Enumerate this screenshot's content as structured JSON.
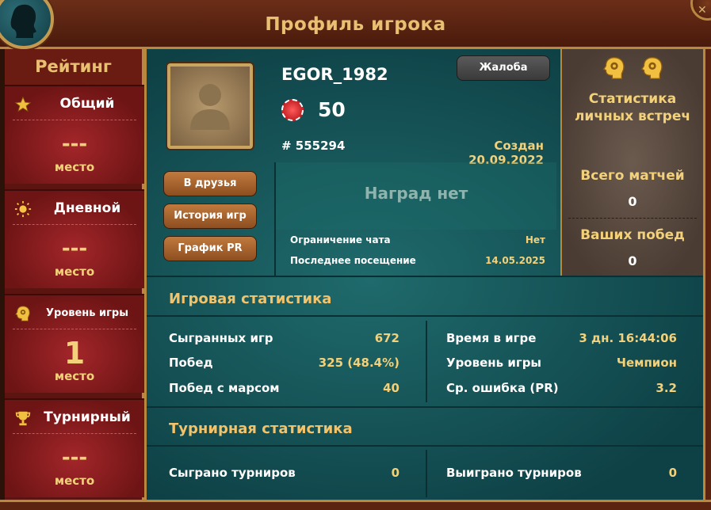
{
  "header": {
    "title": "Профиль игрока"
  },
  "rating": {
    "title": "Рейтинг",
    "items": [
      {
        "label": "Общий",
        "value": "---",
        "place": "место",
        "icon": "star-icon"
      },
      {
        "label": "Дневной",
        "value": "---",
        "place": "место",
        "icon": "sun-icon"
      },
      {
        "label": "Уровень игры",
        "value": "1",
        "place": "место",
        "icon": "brain-gear-icon"
      },
      {
        "label": "Турнирный",
        "value": "---",
        "place": "место",
        "icon": "trophy-icon"
      }
    ]
  },
  "profile": {
    "name": "EGOR_1982",
    "rating": "50",
    "id": "# 555294",
    "created": "Создан 20.09.2022",
    "complain": "Жалоба",
    "buttons": [
      "В друзья",
      "История игр",
      "График PR"
    ],
    "awards": "Наград нет",
    "info": [
      {
        "key": "Ограничение чата",
        "value": "Нет"
      },
      {
        "key": "Последнее посещение",
        "value": "14.05.2025"
      }
    ]
  },
  "h2h": {
    "title": "Статистика личных встреч",
    "total_label": "Всего матчей",
    "total_value": "0",
    "wins_label": "Ваших побед",
    "wins_value": "0"
  },
  "game_stats": {
    "title": "Игровая статистика",
    "left": [
      {
        "key": "Сыгранных игр",
        "value": "672"
      },
      {
        "key": "Побед",
        "value": "325 (48.4%)"
      },
      {
        "key": "Побед с марсом",
        "value": "40"
      }
    ],
    "right": [
      {
        "key": "Время в игре",
        "value": "3 дн. 16:44:06"
      },
      {
        "key": "Уровень игры",
        "value": "Чемпион"
      },
      {
        "key": "Ср. ошибка (PR)",
        "value": "3.2"
      }
    ]
  },
  "tournament_stats": {
    "title": "Турнирная статистика",
    "left": {
      "key": "Сыграно турниров",
      "value": "0"
    },
    "right": {
      "key": "Выиграно турниров",
      "value": "0"
    }
  },
  "colors": {
    "accent_gold": "#f2d17a",
    "panel_teal": "#1f6a6c",
    "frame_gold": "#b9883f",
    "rating_red": "#a3262a"
  }
}
